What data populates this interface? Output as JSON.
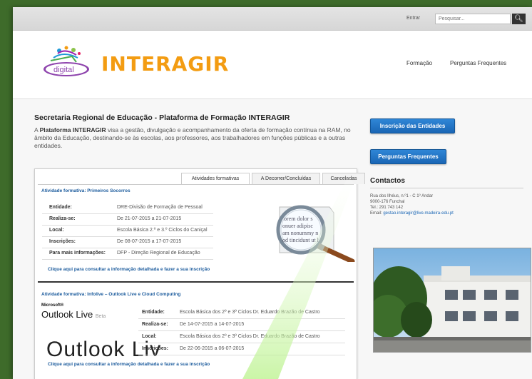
{
  "topbar": {
    "login_label": "Entrar",
    "search_placeholder": "Pesquisar..."
  },
  "header": {
    "logo_small": "digital",
    "logo_name": "INTERAGIR",
    "nav": [
      "Formação",
      "Perguntas Frequentes"
    ]
  },
  "main": {
    "title": "Secretaria Regional de Educação - Plataforma de Formação INTERAGIR",
    "intro_a": "A ",
    "intro_b": "Plataforma INTERAGIR",
    "intro_c": " visa a gestão, divulgação e acompanhamento da oferta de formação contínua na RAM, no âmbito da Educação, destinando-se às escolas, aos professores, aos trabalhadores em funções públicas e a outras entidades."
  },
  "tabs": [
    "Atividades formativas",
    "A Decorrer/Concluídas",
    "Canceladas"
  ],
  "activity1": {
    "title": "Atividade formativa: Primeiros Socorros",
    "rows": [
      {
        "k": "Entidade:",
        "v": "DRE-Divisão de Formação de Pessoal"
      },
      {
        "k": "Realiza-se:",
        "v": "De 21-07-2015 a 21-07-2015"
      },
      {
        "k": "Local:",
        "v": "Escola Básica 2.º e 3.º Ciclos do Caniçal"
      },
      {
        "k": "Inscrições:",
        "v": "De 08-07-2015 a 17-07-2015"
      },
      {
        "k": "Para mais informações:",
        "v": "DFP - Direção Regional de Educação"
      }
    ],
    "link": "Clique aqui para consultar a informação detalhada e fazer a sua inscrição",
    "mag_text": [
      "orem dolor s",
      "onuer adipisc",
      "am nonummy n",
      "od tincidunt ut l"
    ]
  },
  "activity2": {
    "title": "Atividade formativa: Infolive – Outlook Live e Cloud Computing",
    "logo_sup": "Microsoft®",
    "logo_name": "Outlook Live",
    "logo_beta": "Beta",
    "logo_big": "Outlook Liv",
    "rows": [
      {
        "k": "Entidade:",
        "v": "Escola Básica dos 2º e 3º Ciclos Dr. Eduardo Brazão de Castro"
      },
      {
        "k": "Realiza-se:",
        "v": "De 14-07-2015 a 14-07-2015"
      },
      {
        "k": "Local:",
        "v": "Escola Básica dos 2º e 3º Ciclos Dr. Eduardo Brazão de Castro"
      },
      {
        "k": "Inscrições:",
        "v": "De 22-06-2015 a 06-07-2015"
      }
    ],
    "link": "Clique aqui para consultar a informação detalhada e fazer a sua inscrição"
  },
  "sidebar": {
    "btn_inscricao": "Inscrição das Entidades",
    "btn_faq": "Perguntas Frequentes",
    "contacts_title": "Contactos",
    "address1": "Rua dos Ilhéus, n.º1 - C 1º Andar",
    "address2": "9000-176 Funchal",
    "phone": "Tel.: 291 743 142",
    "email_label": "Email: ",
    "email": "gestao.interagir@live.madeira-edu.pt"
  },
  "colors": {
    "accent_orange": "#f39c12",
    "button_blue": "#1a66b5",
    "link_blue": "#1a5a9c"
  },
  "icons": [
    "search-icon",
    "magnifier-icon",
    "logo-icon"
  ]
}
